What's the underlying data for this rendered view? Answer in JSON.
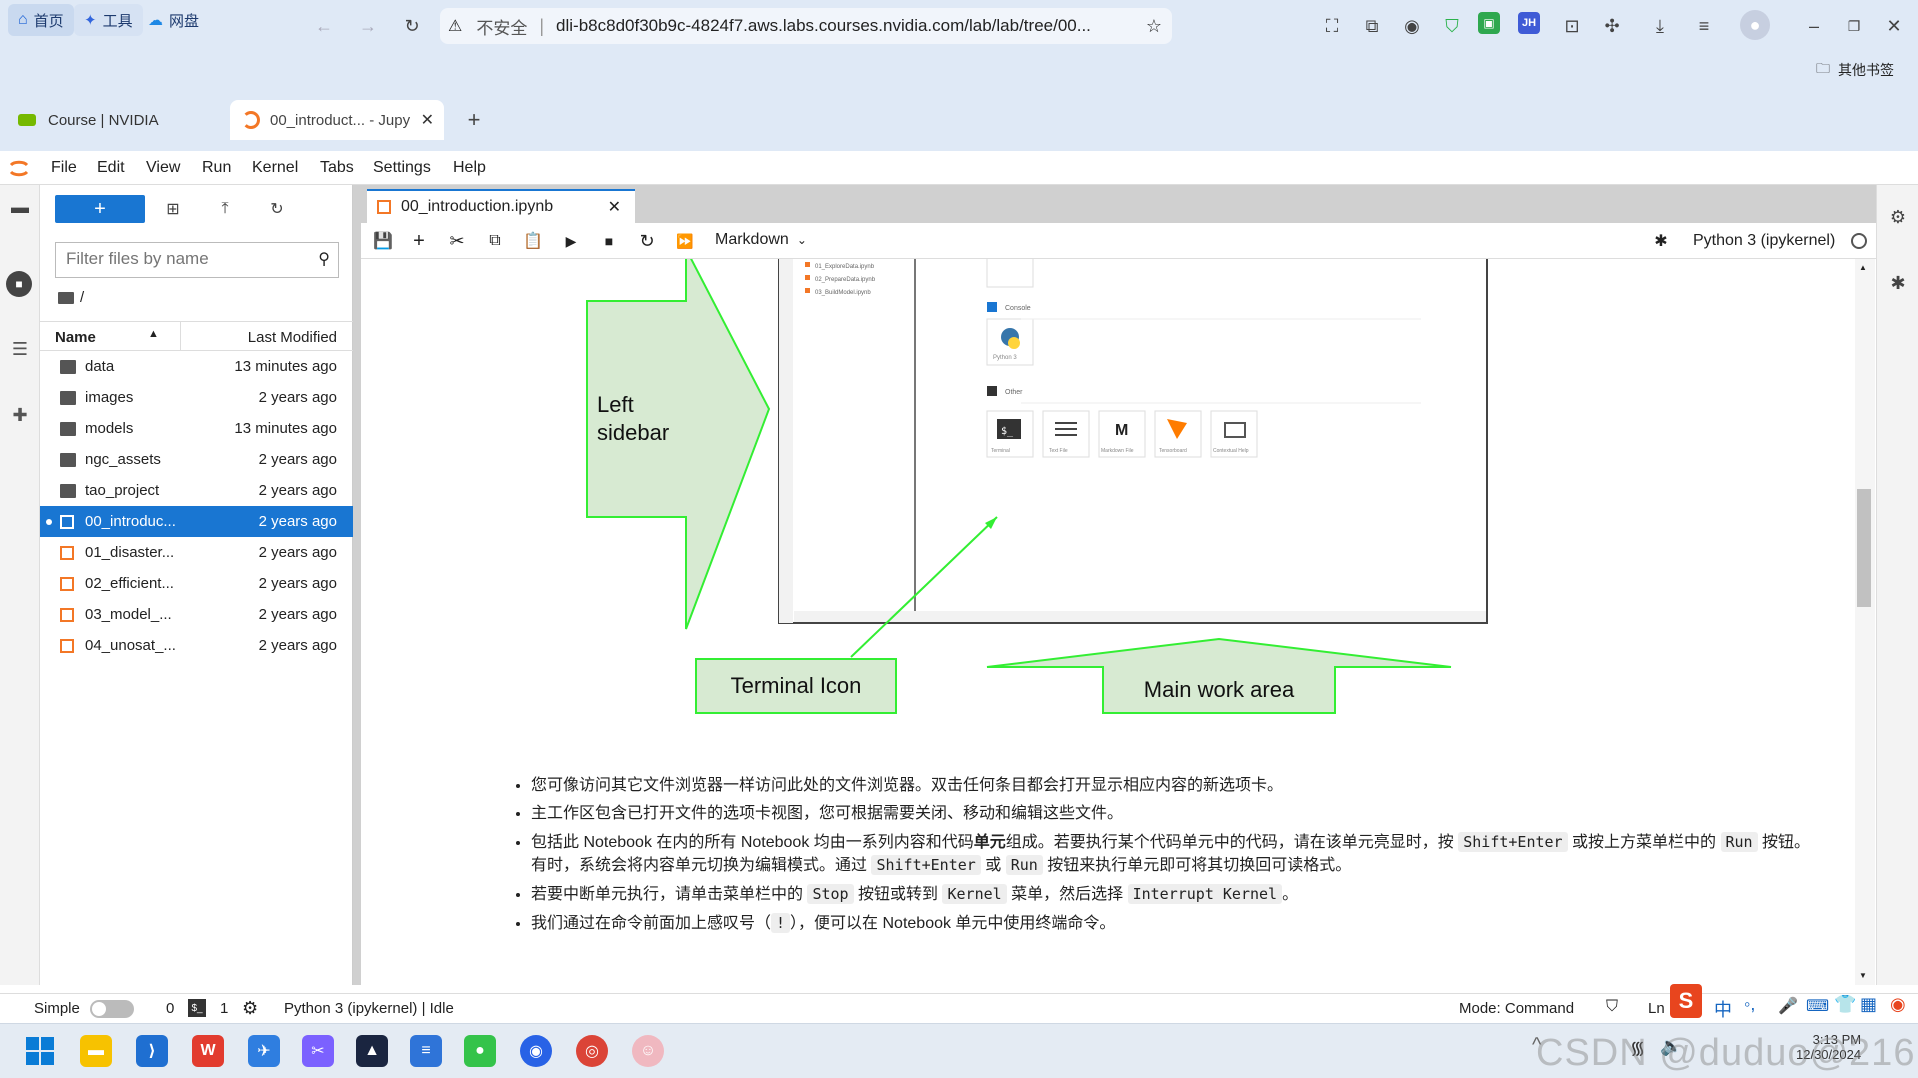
{
  "browser": {
    "nav": [
      {
        "label": "首页",
        "icon": "home-icon"
      },
      {
        "label": "工具",
        "icon": "sparkle-icon"
      },
      {
        "label": "网盘",
        "icon": "cloud-icon"
      }
    ],
    "security_label": "不安全",
    "url": "dli-b8c8d0f30b9c-4824f7.aws.labs.courses.nvidia.com/lab/lab/tree/00...",
    "bookmarks_label": "其他书签",
    "tabs": [
      {
        "label": "Course | NVIDIA",
        "icon": "nvidia-icon"
      },
      {
        "label": "00_introduct... - Jupy",
        "icon": "jupyter-icon"
      }
    ]
  },
  "jupyter": {
    "menu": [
      "File",
      "Edit",
      "View",
      "Run",
      "Kernel",
      "Tabs",
      "Settings",
      "Help"
    ],
    "filebrowser": {
      "new_label": "+",
      "filter_placeholder": "Filter files by name",
      "path": "/",
      "col_name": "Name",
      "col_modified": "Last Modified",
      "items": [
        {
          "name": "data",
          "modified": "13 minutes ago",
          "type": "folder"
        },
        {
          "name": "images",
          "modified": "2 years ago",
          "type": "folder"
        },
        {
          "name": "models",
          "modified": "13 minutes ago",
          "type": "folder"
        },
        {
          "name": "ngc_assets",
          "modified": "2 years ago",
          "type": "folder"
        },
        {
          "name": "tao_project",
          "modified": "2 years ago",
          "type": "folder"
        },
        {
          "name": "00_introduc...",
          "modified": "2 years ago",
          "type": "notebook",
          "selected": true
        },
        {
          "name": "01_disaster...",
          "modified": "2 years ago",
          "type": "notebook"
        },
        {
          "name": "02_efficient...",
          "modified": "2 years ago",
          "type": "notebook"
        },
        {
          "name": "03_model_...",
          "modified": "2 years ago",
          "type": "notebook"
        },
        {
          "name": "04_unosat_...",
          "modified": "2 years ago",
          "type": "notebook"
        }
      ]
    },
    "notebook_tab": "00_introduction.ipynb",
    "cell_type": "Markdown",
    "kernel_name": "Python 3 (ipykernel)",
    "figure": {
      "left_sidebar_label": "Left\nsidebar",
      "terminal_icon_label": "Terminal Icon",
      "main_work_area_label": "Main work area",
      "launcher_section_console": "Console",
      "launcher_section_other": "Other",
      "launcher_items": [
        "Terminal",
        "Text File",
        "Markdown File",
        "Tensorboard",
        "Contextual Help"
      ],
      "python_item": "Python 3",
      "sidebar_files": [
        "01_ExploreData.ipynb",
        "02_PrepareData.ipynb",
        "03_BuildModel.ipynb"
      ]
    },
    "bullets": [
      [
        "您可像访问其它文件浏览器一样访问此处的文件浏览器。双击任何条目都会打开显示相应内容的新选项卡。"
      ],
      [
        "主工作区包含已打开文件的选项卡视图，您可根据需要关闭、移动和编辑这些文件。"
      ],
      [
        "包括此 Notebook 在内的所有 Notebook 均由一系列内容和代码",
        "单元",
        "组成。若要执行某个代码单元中的代码，请在该单元亮显时，按 ",
        "Shift+Enter",
        " 或按上方菜单栏中的 ",
        "Run",
        " 按钮。有时，系统会将内容单元切换为编辑模式。通过 ",
        "Shift+Enter",
        " 或 ",
        "Run",
        " 按钮来执行单元即可将其切换回可读格式。"
      ],
      [
        "若要中断单元执行，请单击菜单栏中的 ",
        "Stop",
        " 按钮或转到 ",
        "Kernel",
        " 菜单，然后选择 ",
        "Interrupt Kernel",
        "。"
      ],
      [
        "我们通过在命令前面加上感叹号（",
        "!",
        "），便可以在 Notebook 单元中使用终端命令。"
      ]
    ],
    "status": {
      "simple_label": "Simple",
      "terminals_count": "0",
      "kernels_count": "1",
      "kernel_status": "Python 3 (ipykernel) | Idle",
      "mode": "Mode: Command",
      "ln": "Ln"
    }
  },
  "taskbar": {
    "time": "3:13 PM",
    "date": "12/30/2024",
    "watermark": "CSDN @duduo@216",
    "ime": "中"
  },
  "colors": {
    "accent": "#1976d2",
    "jupyter_orange": "#f37726",
    "figure_green": "#b8ddb0",
    "figure_stroke": "#33ee33"
  }
}
